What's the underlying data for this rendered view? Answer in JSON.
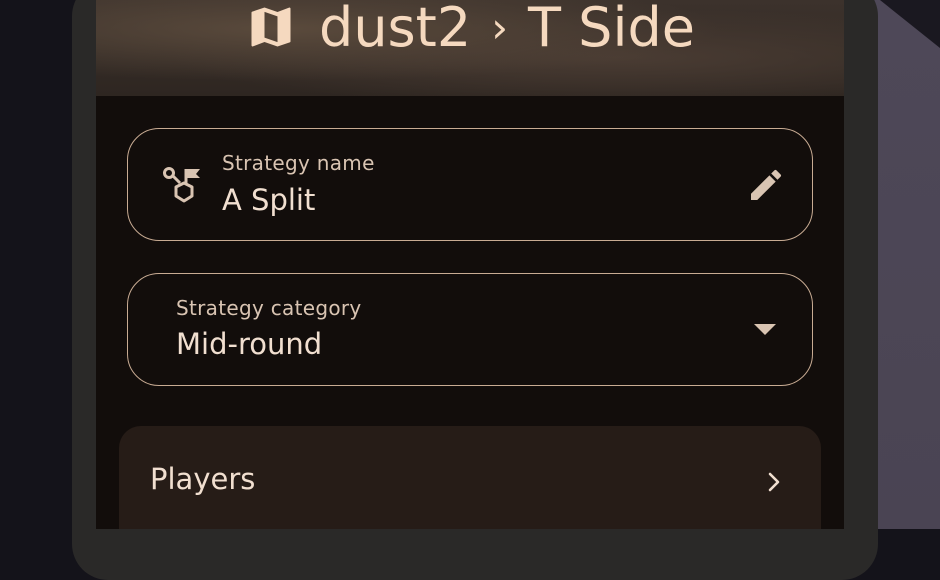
{
  "header": {
    "map_name": "dust2",
    "separator": "›",
    "side": "T Side",
    "map_icon": "map-icon"
  },
  "strategy_name_field": {
    "label": "Strategy name",
    "value": "A Split",
    "leading_icon": "strategy-route-icon",
    "trailing_icon": "edit-pencil-icon"
  },
  "strategy_category_field": {
    "label": "Strategy category",
    "value": "Mid-round",
    "trailing_icon": "dropdown-arrow-icon"
  },
  "players_section": {
    "label": "Players",
    "trailing_icon": "chevron-right-icon"
  },
  "colors": {
    "accent_text": "#f5d9bf",
    "outline": "#c8ab93",
    "surface": "#120d0b",
    "card": "#261c17"
  }
}
